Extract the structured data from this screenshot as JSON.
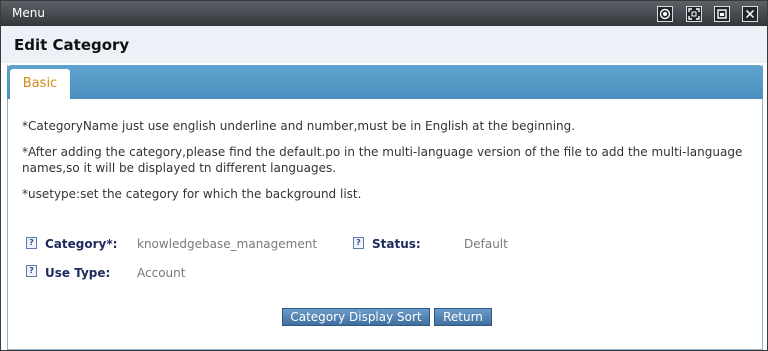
{
  "window": {
    "title": "Menu",
    "controls": [
      "record-icon",
      "fullscreen-icon",
      "restore-icon",
      "close-icon"
    ]
  },
  "page": {
    "heading": "Edit Category"
  },
  "tabs": [
    {
      "label": "Basic",
      "active": true
    }
  ],
  "notes": [
    "*CategoryName just use english underline and number,must be in English at the beginning.",
    "*After adding the category,please find the default.po in the multi-language version of the file to add the multi-language names,so it will be displayed tn different languages.",
    "*usetype:set the category for which the background list."
  ],
  "fields": {
    "category": {
      "label": "Category*:",
      "value": "knowledgebase_management"
    },
    "status": {
      "label": "Status:",
      "value": "Default"
    },
    "use_type": {
      "label": "Use Type:",
      "value": "Account"
    }
  },
  "buttons": {
    "category_display_sort": "Category Display Sort",
    "return": "Return"
  },
  "help_glyph": "?",
  "colors": {
    "titlebar": "#3f4449",
    "header_bg": "#ecf0f7",
    "tabbar": "#5597c6",
    "tab_text": "#d08b18",
    "label": "#1f2a5c",
    "value": "#7a7a7a",
    "button": "#5585b5"
  }
}
